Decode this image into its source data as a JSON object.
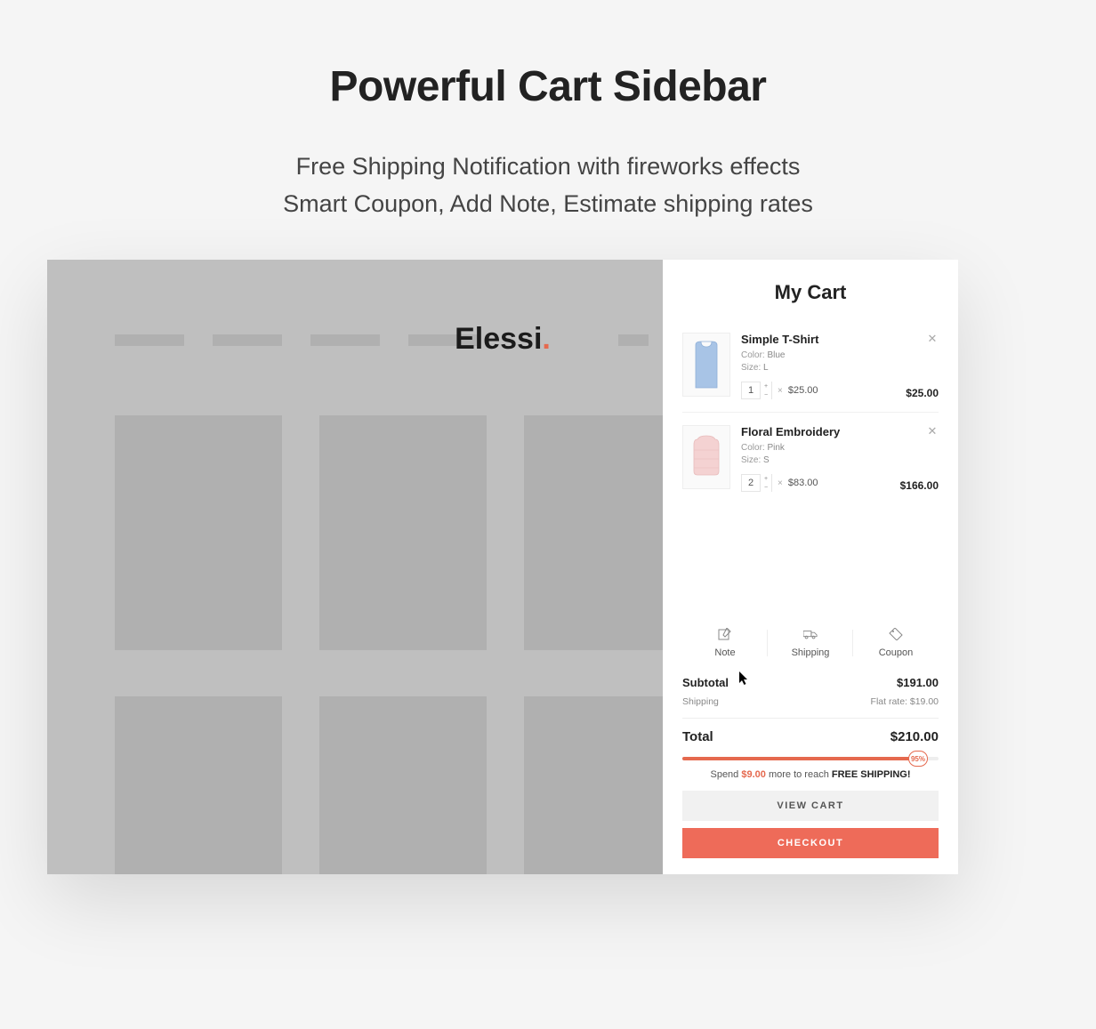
{
  "headline": {
    "title": "Powerful Cart Sidebar",
    "sub1": "Free Shipping Notification with fireworks effects",
    "sub2": "Smart Coupon, Add Note, Estimate shipping rates"
  },
  "brand": {
    "name": "Elessi",
    "dot": "."
  },
  "cart": {
    "title": "My Cart",
    "items": [
      {
        "name": "Simple T-Shirt",
        "colorLabel": "Color:",
        "colorValue": "Blue",
        "sizeLabel": "Size:",
        "sizeValue": "L",
        "qty": "1",
        "unitPrice": "$25.00",
        "lineTotal": "$25.00",
        "thumbColor": "#a8c4e6"
      },
      {
        "name": "Floral Embroidery",
        "colorLabel": "Color:",
        "colorValue": "Pink",
        "sizeLabel": "Size:",
        "sizeValue": "S",
        "qty": "2",
        "unitPrice": "$83.00",
        "lineTotal": "$166.00",
        "thumbColor": "#f4d2d2"
      }
    ],
    "actions": {
      "note": "Note",
      "shipping": "Shipping",
      "coupon": "Coupon"
    },
    "subtotalLabel": "Subtotal",
    "subtotalValue": "$191.00",
    "shippingLabel": "Shipping",
    "shippingValue": "Flat rate: $19.00",
    "totalLabel": "Total",
    "totalValue": "$210.00",
    "progressPercent": "95%",
    "progressWidth": 92,
    "shipMsg": {
      "pre": "Spend ",
      "amt": "$9.00",
      "mid": " more to reach ",
      "free": "FREE SHIPPING!"
    },
    "viewCart": "VIEW CART",
    "checkout": "CHECKOUT"
  }
}
